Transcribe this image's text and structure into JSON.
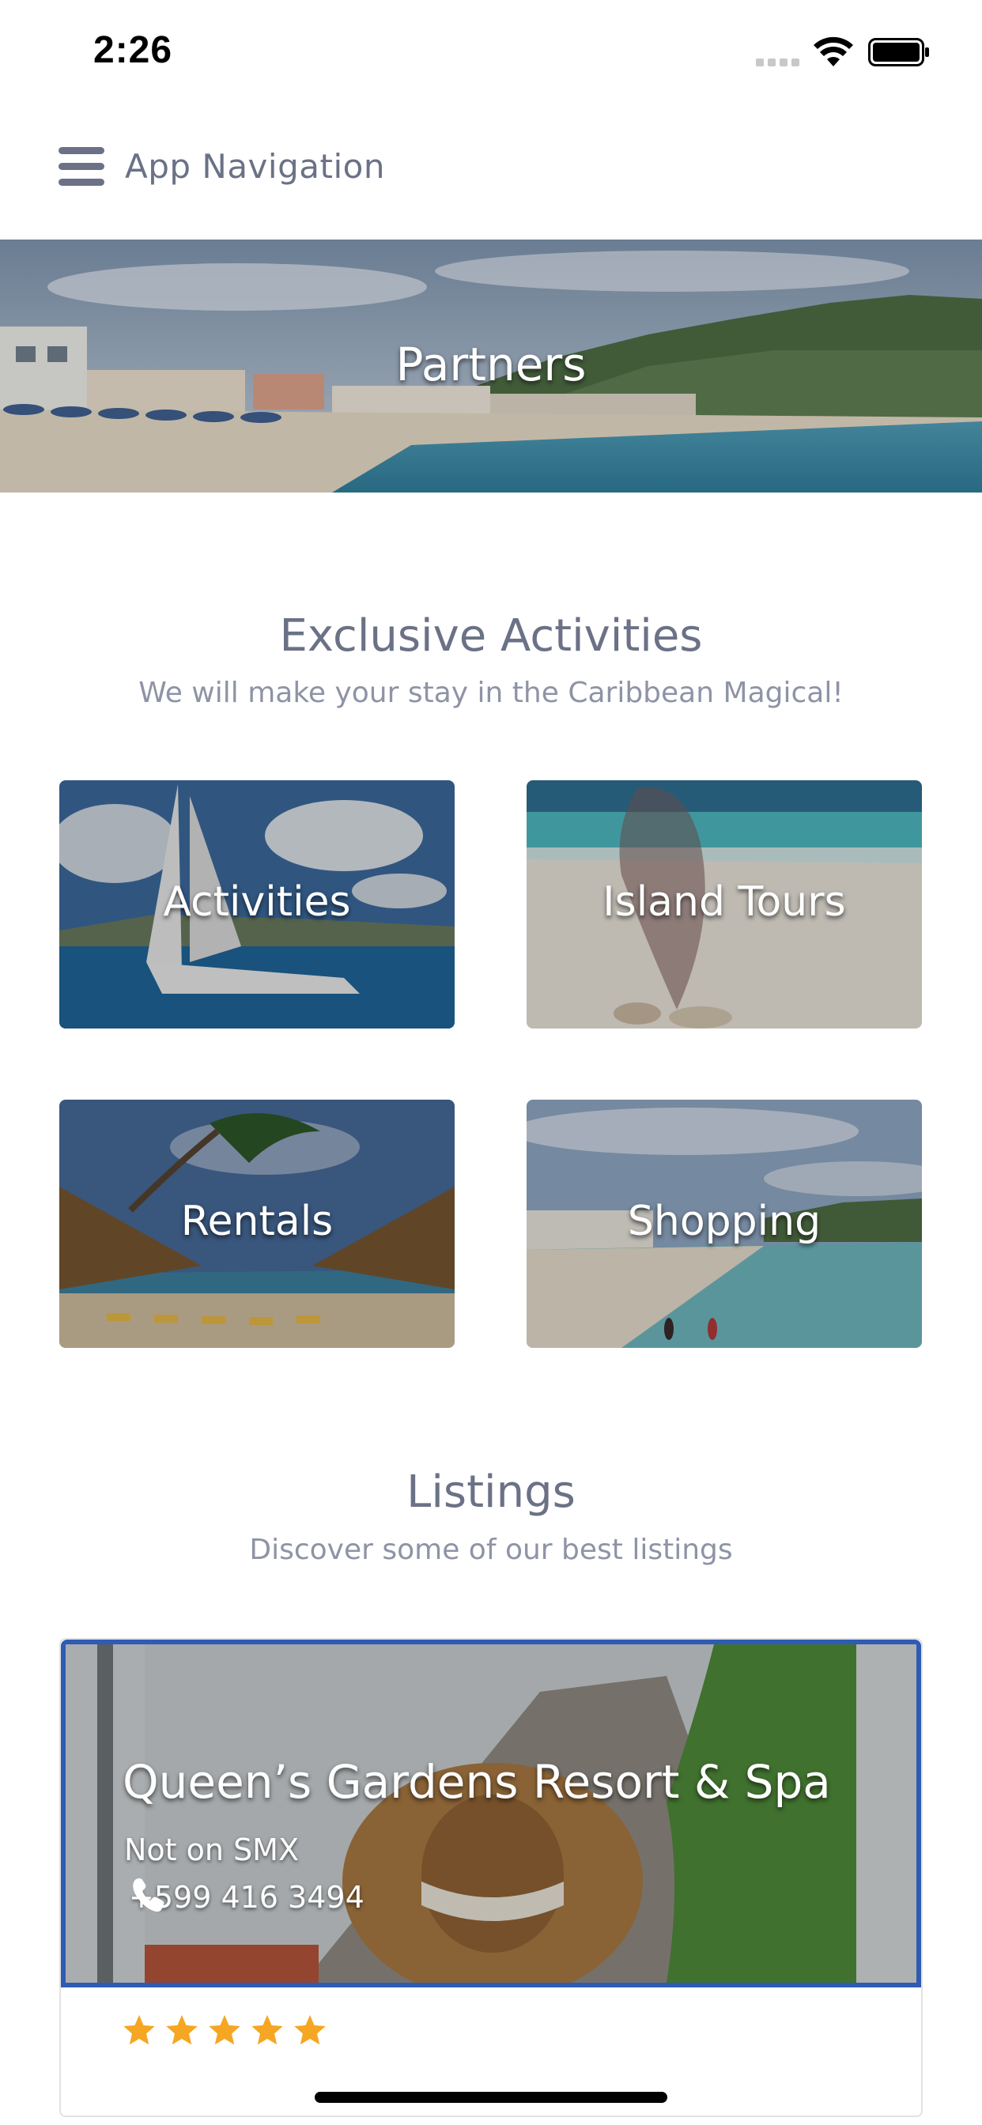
{
  "status_bar": {
    "time": "2:26"
  },
  "app_bar": {
    "title": "App Navigation",
    "menu_icon": "hamburger-menu-icon"
  },
  "hero": {
    "title": "Partners"
  },
  "activities_section": {
    "title": "Exclusive Activities",
    "subtitle": "We will make your stay in the Caribbean Magical!",
    "tiles": [
      {
        "label": "Activities"
      },
      {
        "label": "Island Tours"
      },
      {
        "label": "Rentals"
      },
      {
        "label": "Shopping"
      }
    ]
  },
  "listings_section": {
    "title": "Listings",
    "subtitle": "Discover some of our best listings",
    "listings": [
      {
        "name": "Queen’s Gardens Resort & Spa",
        "location": "Not on SMX",
        "phone": "+599 416 3494",
        "rating": 5
      }
    ]
  },
  "colors": {
    "text": "#6b7186",
    "subtext": "#8e93a6",
    "listing_border": "#2f5bb3",
    "star": "#f5a623"
  }
}
